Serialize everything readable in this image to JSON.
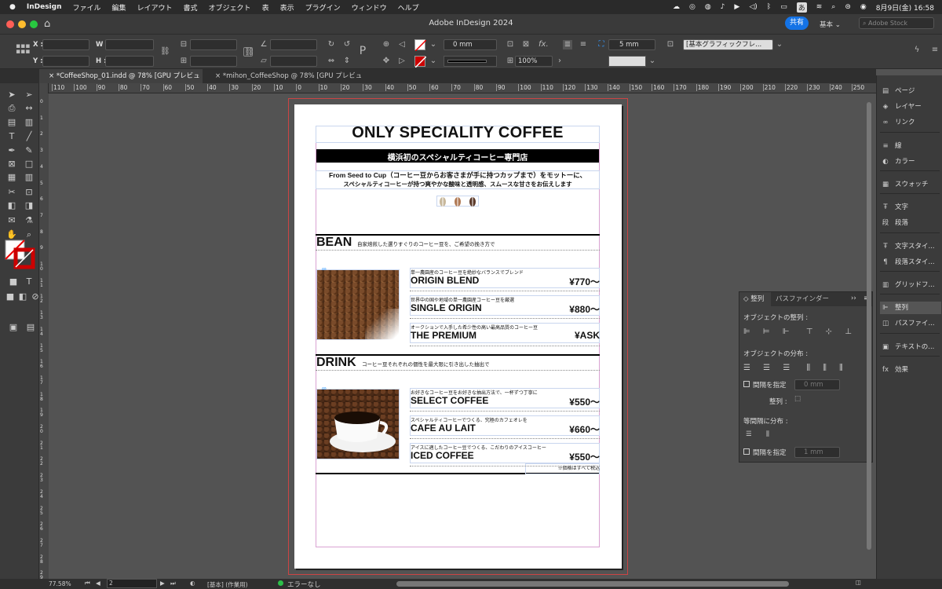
{
  "menubar": {
    "apple": "",
    "app": "InDesign",
    "items": [
      "ファイル",
      "編集",
      "レイアウト",
      "書式",
      "オブジェクト",
      "表",
      "表示",
      "プラグイン",
      "ウィンドウ",
      "ヘルプ"
    ],
    "datetime": "8月9日(金)  16:58",
    "ime": "あ"
  },
  "window": {
    "title": "Adobe InDesign 2024",
    "share": "共有",
    "workspace": "基本",
    "stock_placeholder": "Adobe Stock"
  },
  "control": {
    "x_label": "X :",
    "y_label": "Y :",
    "w_label": "W :",
    "h_label": "H :",
    "stroke_weight": "0 mm",
    "opacity": "100%",
    "gap": "5 mm",
    "object_style": "[基本グラフィックフレ..."
  },
  "tabs": [
    {
      "label": "*CoffeeShop_01.indd @ 78% [GPU プレビュー]",
      "active": true
    },
    {
      "label": "*mihon_CoffeeShop @ 78% [GPU プレビュー]",
      "active": false
    }
  ],
  "ruler": {
    "ticks": [
      "110",
      "100",
      "90",
      "80",
      "70",
      "60",
      "50",
      "40",
      "30",
      "20",
      "10",
      "0",
      "10",
      "20",
      "30",
      "40",
      "50",
      "60",
      "70",
      "80",
      "90",
      "100",
      "110",
      "120",
      "130",
      "140",
      "150",
      "160",
      "170",
      "180",
      "190",
      "200",
      "210",
      "220",
      "230",
      "240",
      "250"
    ]
  },
  "vruler": {
    "ticks": [
      "0",
      "1",
      "2",
      "3",
      "4",
      "5",
      "6",
      "7",
      "8",
      "9",
      "1 0",
      "1 1",
      "1 2",
      "1 3",
      "1 4",
      "1 5",
      "1 6",
      "1 7",
      "1 8",
      "1 9",
      "2 0",
      "2 1",
      "2 2",
      "2 3",
      "2 4",
      "2 5",
      "2 6",
      "2 7",
      "2 8",
      "2 9"
    ]
  },
  "panels": {
    "items": [
      {
        "label": "ページ",
        "icon": "pages-icon",
        "glyph": "▤"
      },
      {
        "label": "レイヤー",
        "icon": "layers-icon",
        "glyph": "◈"
      },
      {
        "label": "リンク",
        "icon": "links-icon",
        "glyph": "∞"
      },
      {
        "label": "線",
        "icon": "stroke-icon",
        "glyph": "≡"
      },
      {
        "label": "カラー",
        "icon": "color-icon",
        "glyph": "◐"
      },
      {
        "label": "スウォッチ",
        "icon": "swatches-icon",
        "glyph": "▦"
      },
      {
        "label": "文字",
        "icon": "character-icon",
        "glyph": "Ŧ"
      },
      {
        "label": "段落",
        "icon": "paragraph-icon",
        "glyph": "段"
      },
      {
        "label": "文字スタイ...",
        "icon": "char-style-icon",
        "glyph": "Ŧ"
      },
      {
        "label": "段落スタイ...",
        "icon": "para-style-icon",
        "glyph": "¶"
      },
      {
        "label": "グリッドフ...",
        "icon": "grid-icon",
        "glyph": "▥"
      },
      {
        "label": "整列",
        "icon": "align-icon",
        "glyph": "⊫"
      },
      {
        "label": "パスファイ...",
        "icon": "pathfinder-icon",
        "glyph": "◫"
      },
      {
        "label": "テキストの...",
        "icon": "text-wrap-icon",
        "glyph": "▣"
      },
      {
        "label": "効果",
        "icon": "effects-icon",
        "glyph": "fx"
      }
    ]
  },
  "align_panel": {
    "tab_align": "整列",
    "tab_pathfinder": "パスファインダー",
    "align_objects": "オブジェクトの整列 :",
    "distribute_objects": "オブジェクトの分布 :",
    "use_spacing": "間隔を指定",
    "spacing_value": "0 mm",
    "align_to": "整列 :",
    "distribute_spacing": "等間隔に分布 :",
    "use_spacing2": "間隔を指定",
    "spacing_value2": "1 mm"
  },
  "status": {
    "zoom": "77.58%",
    "page": "2",
    "style": "[基本] (作業用)",
    "errors": "エラーなし"
  },
  "doc": {
    "title": "ONLY SPECIALITY COFFEE",
    "subtitle": "横浜初のスペシャルティコーヒー専門店",
    "intro1": "From Seed to Cup（コーヒー豆からお客さまが手に持つカップまで）をモットーに、",
    "intro2": "スペシャルティコーヒーが持つ爽やかな酸味と透明感、スムースな甘さをお伝えします",
    "bean_heading": "BEAN",
    "bean_desc": "自家焙煎した選りすぐりのコーヒー豆を、ご希望の挽き方で",
    "beans": [
      {
        "desc": "単一農園産のコーヒー豆を絶妙なバランスでブレンド",
        "name": "ORIGIN BLEND",
        "price": "¥770〜"
      },
      {
        "desc": "世界中の国や地域の単一農園産コーヒー豆を厳選",
        "name": "SINGLE ORIGIN",
        "price": "¥880〜"
      },
      {
        "desc": "オークションで入手した希少性の高い最高品質のコーヒー豆",
        "name": "THE PREMIUM",
        "price": "¥ASK"
      }
    ],
    "drink_heading": "DRINK",
    "drink_desc": "コーヒー豆それぞれの個性を最大限に引き出した抽出で",
    "drinks": [
      {
        "desc": "お好きなコーヒー豆をお好きな抽出方法で、一杯ずつ丁寧に",
        "name": "SELECT COFFEE",
        "price": "¥550〜"
      },
      {
        "desc": "スペシャルティコーヒーでつくる、究極のカフェオレを",
        "name": "CAFE AU LAIT",
        "price": "¥660〜"
      },
      {
        "desc": "アイスに適したコーヒー豆でつくる、こだわりのアイスコーヒー",
        "name": "ICED COFFEE",
        "price": "¥550〜"
      }
    ],
    "tax_note": "※価格はすべて税込"
  }
}
